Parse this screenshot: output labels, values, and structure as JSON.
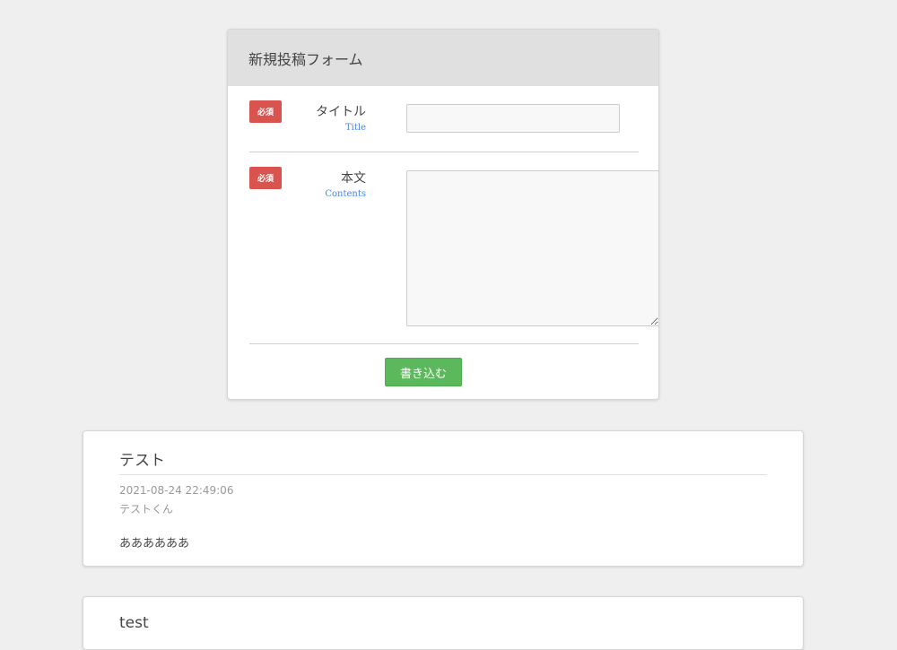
{
  "form": {
    "header_title": "新規投稿フォーム",
    "required_badge": "必須",
    "title_field": {
      "label": "タイトル",
      "sublabel": "Title",
      "value": "",
      "placeholder": ""
    },
    "contents_field": {
      "label": "本文",
      "sublabel": "Contents",
      "value": "",
      "placeholder": ""
    },
    "submit_label": "書き込む"
  },
  "posts": [
    {
      "title": "テスト",
      "datetime": "2021-08-24 22:49:06",
      "author": "テストくん",
      "body": "ああああああ"
    },
    {
      "title": "test"
    }
  ],
  "colors": {
    "background": "#efefef",
    "required_badge": "#d9534f",
    "submit_button": "#5cb85c",
    "sublabel": "#4a86e8"
  }
}
